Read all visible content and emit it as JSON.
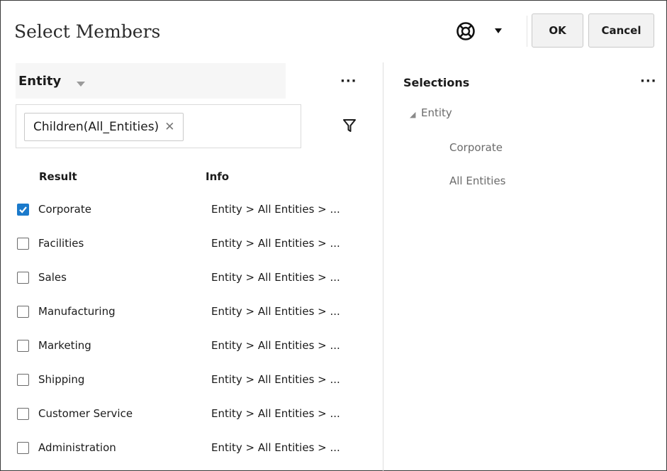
{
  "dialog": {
    "title": "Select Members",
    "ok_label": "OK",
    "cancel_label": "Cancel"
  },
  "left": {
    "dimension_label": "Entity",
    "more_label": "···",
    "search_chip": "Children(All_Entities)",
    "chip_remove": "✕",
    "columns": {
      "result": "Result",
      "info": "Info"
    },
    "rows": [
      {
        "label": "Corporate",
        "info": "Entity > All Entities > ...",
        "checked": true
      },
      {
        "label": "Facilities",
        "info": "Entity > All Entities > ...",
        "checked": false
      },
      {
        "label": "Sales",
        "info": "Entity > All Entities > ...",
        "checked": false
      },
      {
        "label": "Manufacturing",
        "info": "Entity > All Entities > ...",
        "checked": false
      },
      {
        "label": "Marketing",
        "info": "Entity > All Entities > ...",
        "checked": false
      },
      {
        "label": "Shipping",
        "info": "Entity > All Entities > ...",
        "checked": false
      },
      {
        "label": "Customer Service",
        "info": "Entity > All Entities > ...",
        "checked": false
      },
      {
        "label": "Administration",
        "info": "Entity > All Entities > ...",
        "checked": false
      }
    ]
  },
  "right": {
    "title": "Selections",
    "more_label": "···",
    "tree": {
      "root": "Entity",
      "children": [
        "Corporate",
        "All Entities"
      ]
    }
  },
  "colors": {
    "accent": "#1b7acb"
  },
  "icons": [
    "help-lifebuoy-icon",
    "caret-down-icon",
    "filter-icon",
    "checkbox-icon",
    "expand-triangle-icon"
  ]
}
